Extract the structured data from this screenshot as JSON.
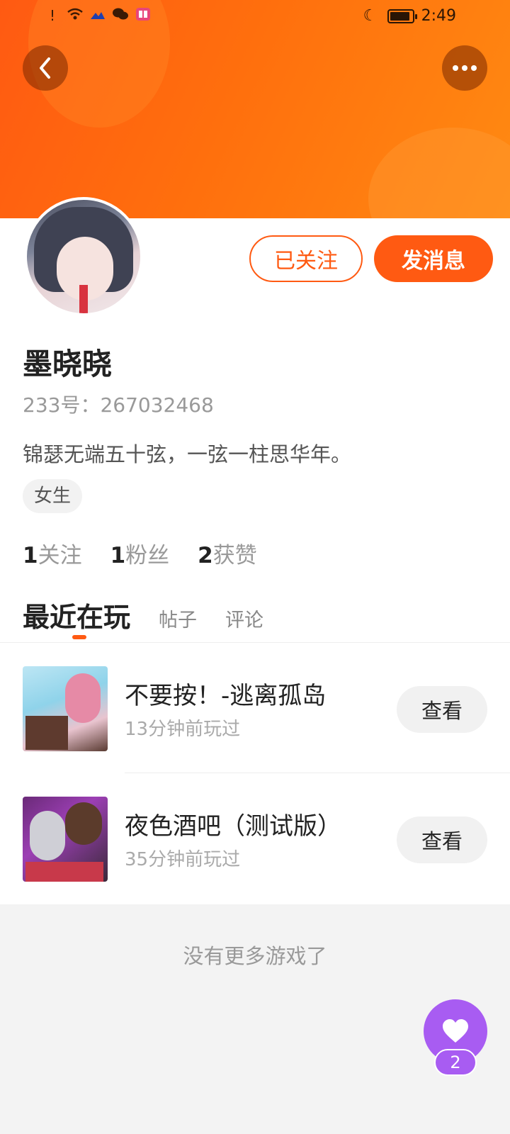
{
  "status_bar": {
    "time": "2:49",
    "icons": [
      "alert-icon",
      "wifi-icon",
      "cloud-icon",
      "wechat-icon",
      "book-icon",
      "moon-icon",
      "battery-icon"
    ]
  },
  "header": {
    "back_icon": "chevron-left-icon",
    "more_icon": "more-dots-icon"
  },
  "profile": {
    "followed_label": "已关注",
    "message_label": "发消息",
    "username": "墨晓晓",
    "uid": "233号：267032468",
    "bio": "锦瑟无端五十弦，一弦一柱思华年。",
    "gender_tag": "女生"
  },
  "stats": [
    {
      "count": "1",
      "label": "关注"
    },
    {
      "count": "1",
      "label": "粉丝"
    },
    {
      "count": "2",
      "label": "获赞"
    }
  ],
  "tabs": [
    {
      "label": "最近在玩"
    },
    {
      "label": "帖子"
    },
    {
      "label": "评论"
    }
  ],
  "games": [
    {
      "title": "不要按！-逃离孤岛",
      "time": "13分钟前玩过",
      "button": "查看"
    },
    {
      "title": "夜色酒吧（测试版）",
      "time": "35分钟前玩过",
      "button": "查看"
    }
  ],
  "footer": {
    "no_more": "没有更多游戏了"
  },
  "fab": {
    "icon": "heart-icon",
    "count": "2"
  },
  "colors": {
    "accent": "#ff5a12",
    "fab": "#a85cf2"
  }
}
